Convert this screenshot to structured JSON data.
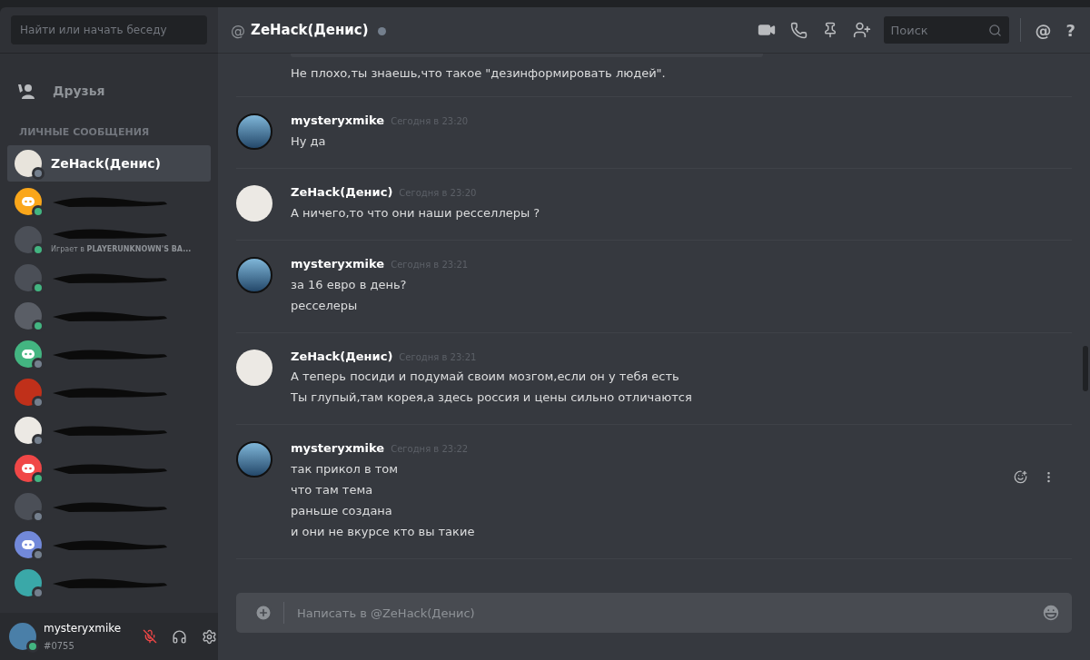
{
  "sidebar": {
    "search": {
      "placeholder": "Найти или начать беседу"
    },
    "friends": {
      "label": "Друзья"
    },
    "section_title": "ЛИЧНЫЕ СООБЩЕНИЯ",
    "dms": [
      {
        "name": "ZeHack(Денис)",
        "selected": true,
        "kind": "photo",
        "color": "#e8e4dc",
        "online": false
      },
      {
        "selected": false,
        "kind": "discord",
        "color": "#faa61a",
        "online": true
      },
      {
        "selected": false,
        "kind": "photo",
        "color": "#4b4f57",
        "online": true,
        "activity": "Играет в **PLAYERUNKNOWN'S BA...**"
      },
      {
        "selected": false,
        "kind": "photo",
        "color": "#4b4f57",
        "online": true
      },
      {
        "selected": false,
        "kind": "photo",
        "color": "#5a5e66",
        "online": true
      },
      {
        "selected": false,
        "kind": "discord",
        "color": "#43b581",
        "online": false
      },
      {
        "selected": false,
        "kind": "photo",
        "color": "#c0301a",
        "online": false
      },
      {
        "selected": false,
        "kind": "photo",
        "color": "#ece9e4",
        "online": false
      },
      {
        "selected": false,
        "kind": "discord",
        "color": "#f04747",
        "online": true
      },
      {
        "selected": false,
        "kind": "photo",
        "color": "#4b4f57",
        "online": false
      },
      {
        "selected": false,
        "kind": "discord",
        "color": "#7289da",
        "online": false
      },
      {
        "selected": false,
        "kind": "photo",
        "color": "#3aa8a8",
        "online": false
      }
    ],
    "user": {
      "name": "mysteryxmike",
      "tag": "#0755",
      "online": true,
      "muted": true
    }
  },
  "header": {
    "at": "@",
    "title": "ZeHack(Денис)",
    "online": false,
    "search": {
      "placeholder": "Поиск"
    },
    "mention": "@",
    "help": "?"
  },
  "messages": [
    {
      "lines": [
        "Не плохо,ты знаешь,что такое \"дезинформировать людей\"."
      ],
      "hovered": false
    },
    {
      "author": "mysteryxmike",
      "kind": "city",
      "time": "Сегодня в 23:20",
      "lines": [
        "Ну да"
      ],
      "hovered": false
    },
    {
      "author": "ZeHack(Денис)",
      "kind": "soldier",
      "time": "Сегодня в 23:20",
      "lines": [
        "А ничего,то что они наши ресселлеры ?"
      ],
      "hovered": false
    },
    {
      "author": "mysteryxmike",
      "kind": "city",
      "time": "Сегодня в 23:21",
      "lines": [
        "за 16 евро в день?",
        "ресселеры"
      ],
      "hovered": false
    },
    {
      "author": "ZeHack(Денис)",
      "kind": "soldier",
      "time": "Сегодня в 23:21",
      "lines": [
        "А теперь посиди и подумай своим мозгом,если он у тебя есть",
        "Ты глупый,там корея,а здесь россия и цены сильно отличаются"
      ],
      "hovered": false
    },
    {
      "author": "mysteryxmike",
      "kind": "city",
      "time": "Сегодня в 23:22",
      "lines": [
        "так прикол в том",
        "что там тема",
        "раньше создана",
        "и они не вкурсе кто вы такие"
      ],
      "hovered": true
    }
  ],
  "composer": {
    "placeholder": "Написать в @ZeHack(Денис)"
  }
}
